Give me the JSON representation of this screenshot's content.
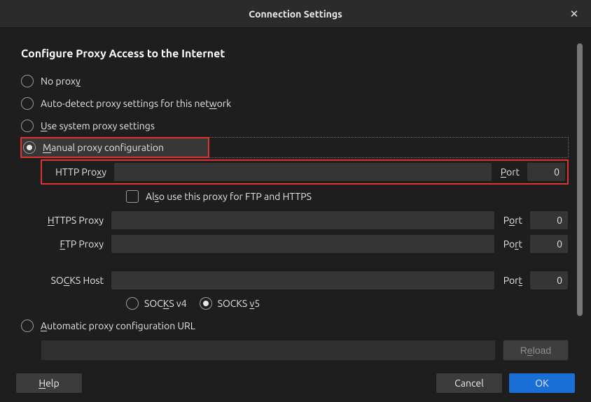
{
  "title": "Connection Settings",
  "section_title": "Configure Proxy Access to the Internet",
  "radios": {
    "no_proxy_pre": "No prox",
    "no_proxy_ul": "y",
    "no_proxy_post": "",
    "autodetect_pre": "Auto-detect proxy settings for this net",
    "autodetect_ul": "w",
    "autodetect_post": "ork",
    "system_pre": "",
    "system_ul": "U",
    "system_post": "se system proxy settings",
    "manual_pre": "",
    "manual_ul": "M",
    "manual_post": "anual proxy configuration",
    "auto_url_pre": "",
    "auto_url_ul": "A",
    "auto_url_post": "utomatic proxy configuration URL"
  },
  "fields": {
    "http_label_pre": "HTTP Pro",
    "http_label_ul": "x",
    "http_label_post": "y",
    "http_port_label_pre": "",
    "http_port_label_ul": "P",
    "http_port_label_post": "ort",
    "http_port_value": "0",
    "also_pre": "Al",
    "also_ul": "s",
    "also_post": "o use this proxy for FTP and HTTPS",
    "https_label_pre": "",
    "https_label_ul": "H",
    "https_label_post": "TTPS Proxy",
    "https_port_label_pre": "P",
    "https_port_label_ul": "o",
    "https_port_label_post": "rt",
    "https_port_value": "0",
    "ftp_label_pre": "",
    "ftp_label_ul": "F",
    "ftp_label_post": "TP Proxy",
    "ftp_port_label_pre": "Po",
    "ftp_port_label_ul": "r",
    "ftp_port_label_post": "t",
    "ftp_port_value": "0",
    "socks_label_pre": "SO",
    "socks_label_ul": "C",
    "socks_label_post": "KS Host",
    "socks_port_label_pre": "Por",
    "socks_port_label_ul": "t",
    "socks_port_label_post": "",
    "socks_port_value": "0",
    "socks_v4_pre": "SOC",
    "socks_v4_ul": "K",
    "socks_v4_post": "S v4",
    "socks_v5_pre": "SOCKS ",
    "socks_v5_ul": "v",
    "socks_v5_post": "5"
  },
  "buttons": {
    "reload_pre": "R",
    "reload_ul": "e",
    "reload_post": "load",
    "help_pre": "",
    "help_ul": "H",
    "help_post": "elp",
    "cancel": "Cancel",
    "ok": "OK"
  }
}
